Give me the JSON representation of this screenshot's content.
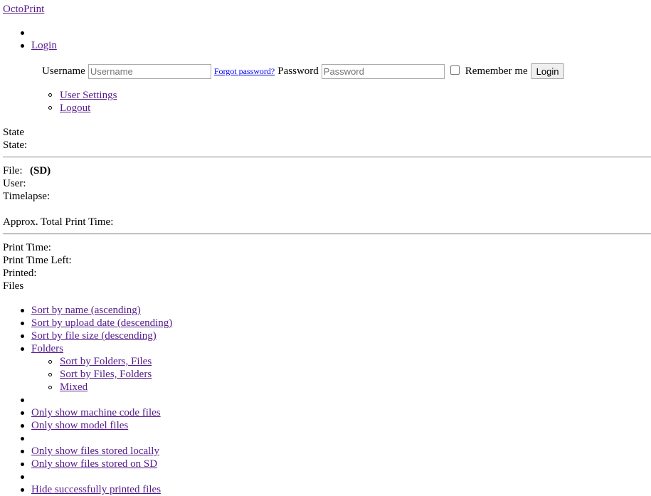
{
  "navbar": {
    "brand": "OctoPrint",
    "login_link": "Login",
    "login_form": {
      "username_label": "Username",
      "username_placeholder": "Username",
      "forgot_password": "Forgot password?",
      "password_label": "Password",
      "password_placeholder": "Password",
      "remember_label": "Remember me",
      "login_button": "Login"
    },
    "user_menu": [
      "User Settings",
      "Logout"
    ]
  },
  "state": {
    "heading": "State",
    "state_label": "State:",
    "file_label": "File:",
    "file_origin": "(SD)",
    "user_label": "User:",
    "timelapse_label": "Timelapse:",
    "approx_total_label": "Approx. Total Print Time:",
    "print_time_label": "Print Time:",
    "print_time_left_label": "Print Time Left:",
    "printed_label": "Printed:"
  },
  "files": {
    "heading": "Files",
    "sort_options": [
      "Sort by name (ascending)",
      "Sort by upload date (descending)",
      "Sort by file size (descending)"
    ],
    "folders_label": "Folders",
    "folder_options": [
      "Sort by Folders, Files",
      "Sort by Files, Folders",
      "Mixed"
    ],
    "filter_type": [
      "Only show machine code files",
      "Only show model files"
    ],
    "filter_location": [
      "Only show files stored locally",
      "Only show files stored on SD"
    ],
    "hide_printed": "Hide successfully printed files"
  },
  "colors": {
    "link_visited": "#551a8b",
    "link_unvisited": "#0000ee",
    "rule": "#a0a0a0"
  }
}
